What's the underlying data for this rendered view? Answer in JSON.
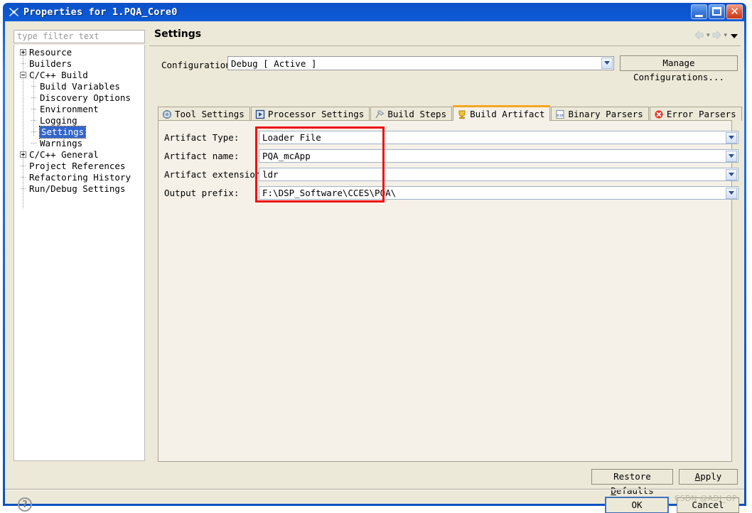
{
  "window": {
    "title": "Properties for 1.PQA_Core0",
    "icon": "app-icon",
    "buttons": {
      "minimize": "minimize-icon",
      "maximize": "maximize-icon",
      "close": "close-icon"
    }
  },
  "sidebar": {
    "filter": {
      "placeholder": "type filter text",
      "value": ""
    },
    "items": [
      {
        "label": "Resource",
        "indent": 0,
        "twisty": "plus",
        "selected": false
      },
      {
        "label": "Builders",
        "indent": 0,
        "twisty": "none",
        "selected": false
      },
      {
        "label": "C/C++ Build",
        "indent": 0,
        "twisty": "minus",
        "selected": false
      },
      {
        "label": "Build Variables",
        "indent": 1,
        "twisty": "none",
        "selected": false
      },
      {
        "label": "Discovery Options",
        "indent": 1,
        "twisty": "none",
        "selected": false
      },
      {
        "label": "Environment",
        "indent": 1,
        "twisty": "none",
        "selected": false
      },
      {
        "label": "Logging",
        "indent": 1,
        "twisty": "none",
        "selected": false
      },
      {
        "label": "Settings",
        "indent": 1,
        "twisty": "none",
        "selected": true
      },
      {
        "label": "Warnings",
        "indent": 1,
        "twisty": "none",
        "selected": false
      },
      {
        "label": "C/C++ General",
        "indent": 0,
        "twisty": "plus",
        "selected": false
      },
      {
        "label": "Project References",
        "indent": 0,
        "twisty": "none",
        "selected": false
      },
      {
        "label": "Refactoring History",
        "indent": 0,
        "twisty": "none",
        "selected": false
      },
      {
        "label": "Run/Debug Settings",
        "indent": 0,
        "twisty": "none",
        "selected": false
      }
    ]
  },
  "page": {
    "title": "Settings",
    "nav": {
      "back": "back-arrow-icon",
      "forward": "forward-arrow-icon",
      "menu": "chevron-down-icon"
    }
  },
  "configuration": {
    "label": "Configuration:",
    "value": "Debug  [ Active ]",
    "manage_button": "Manage Configurations..."
  },
  "tabs": [
    {
      "label": "Tool Settings",
      "icon": "tool-settings-icon",
      "active": false
    },
    {
      "label": "Processor Settings",
      "icon": "processor-settings-icon",
      "active": false
    },
    {
      "label": "Build Steps",
      "icon": "build-steps-icon",
      "active": false
    },
    {
      "label": "Build Artifact",
      "icon": "build-artifact-icon",
      "active": true
    },
    {
      "label": "Binary Parsers",
      "icon": "binary-parsers-icon",
      "active": false
    },
    {
      "label": "Error Parsers",
      "icon": "error-parsers-icon",
      "active": false
    }
  ],
  "fields": [
    {
      "label": "Artifact Type:",
      "value": "Loader File"
    },
    {
      "label": "Artifact name:",
      "value": "PQA_mcApp"
    },
    {
      "label": "Artifact extension:",
      "value": "ldr"
    },
    {
      "label": "Output prefix:",
      "value": "F:\\DSP_Software\\CCES\\PQA\\"
    }
  ],
  "annotation": {
    "color": "#ee1111"
  },
  "buttons": {
    "restore_defaults_pre": "Restore ",
    "restore_defaults_key": "D",
    "restore_defaults_post": "efaults",
    "apply_pre": "",
    "apply_key": "A",
    "apply_post": "pply",
    "ok": "OK",
    "cancel": "Cancel"
  },
  "footer": {
    "help": "?",
    "watermark": "CSDN @ADI_OP"
  }
}
